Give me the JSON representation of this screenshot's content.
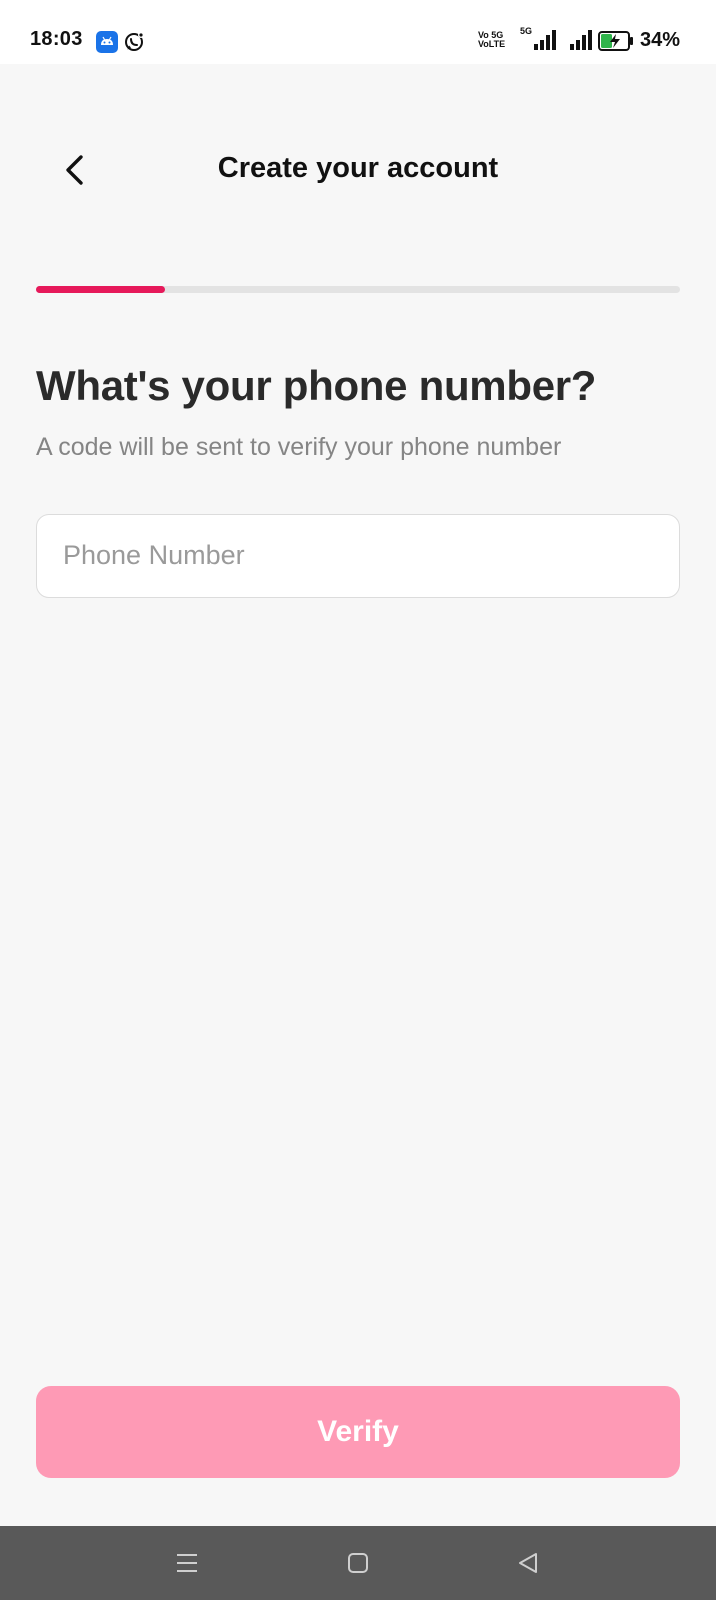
{
  "status_bar": {
    "time": "18:03",
    "network_line1": "Vo 5G",
    "network_line2": "VoLTE",
    "five_g": "5G",
    "battery": "34%",
    "icons": [
      "android-app-icon",
      "whatsapp-icon",
      "signal-icon",
      "battery-charging-icon"
    ]
  },
  "header": {
    "title": "Create your account",
    "back_icon": "chevron-left-icon"
  },
  "progress": {
    "value": 0.2,
    "accent": "#e6195a",
    "track": "#e3e3e3"
  },
  "form": {
    "heading": "What's your phone number?",
    "subheading": "A code will be sent to verify your phone number",
    "phone_placeholder": "Phone Number",
    "phone_value": ""
  },
  "actions": {
    "verify_label": "Verify",
    "verify_color": "#fe9ab5"
  },
  "nav": {
    "icons": [
      "menu-icon",
      "home-icon",
      "back-icon"
    ]
  }
}
